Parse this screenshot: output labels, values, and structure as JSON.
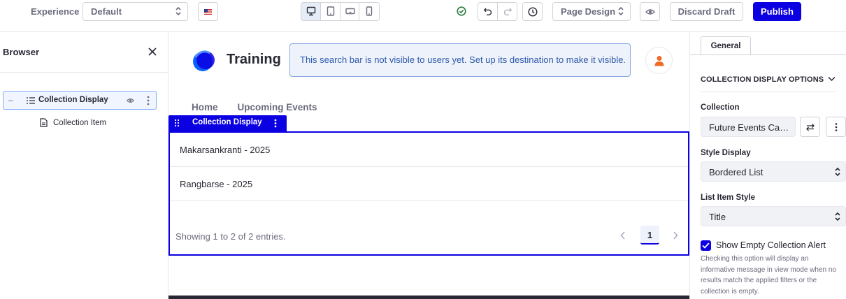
{
  "toolbar": {
    "experience_label": "Experience",
    "experience_value": "Default",
    "language_flag": "us-flag-icon",
    "device_buttons": [
      "desktop-icon",
      "tablet-icon",
      "landscape-phone-icon",
      "portrait-phone-icon"
    ],
    "page_design_label": "Page Design",
    "discard_label": "Discard Draft",
    "publish_label": "Publish"
  },
  "browser": {
    "title": "Browser",
    "tree": {
      "item_label": "Collection Display",
      "child_label": "Collection Item"
    }
  },
  "canvas": {
    "site_name": "Training",
    "search_notice": "This search bar is not visible to users yet. Set up its destination to make it visible.",
    "nav": [
      "Home",
      "Upcoming Events"
    ],
    "fragment_label": "Collection Display",
    "items": [
      "Makarsankranti - 2025",
      "Rangbarse - 2025"
    ],
    "pagination_summary": "Showing 1 to 2 of 2 entries.",
    "current_page": "1"
  },
  "panel": {
    "tab_label": "General",
    "section_title": "COLLECTION DISPLAY OPTIONS",
    "collection_label": "Collection",
    "collection_value": "Future Events Ca…",
    "style_display_label": "Style Display",
    "style_display_value": "Bordered List",
    "list_item_style_label": "List Item Style",
    "list_item_style_value": "Title",
    "empty_alert_label": "Show Empty Collection Alert",
    "empty_alert_checked": true,
    "empty_alert_help": "Checking this option will display an informative message in view mode when no results match the applied filters or the collection is empty."
  },
  "colors": {
    "primary": "#0b00e1",
    "success": "#287d3c",
    "info_bg": "#eef2fa",
    "info_text": "#2e5aac",
    "avatar_orange": "#f06a26"
  }
}
